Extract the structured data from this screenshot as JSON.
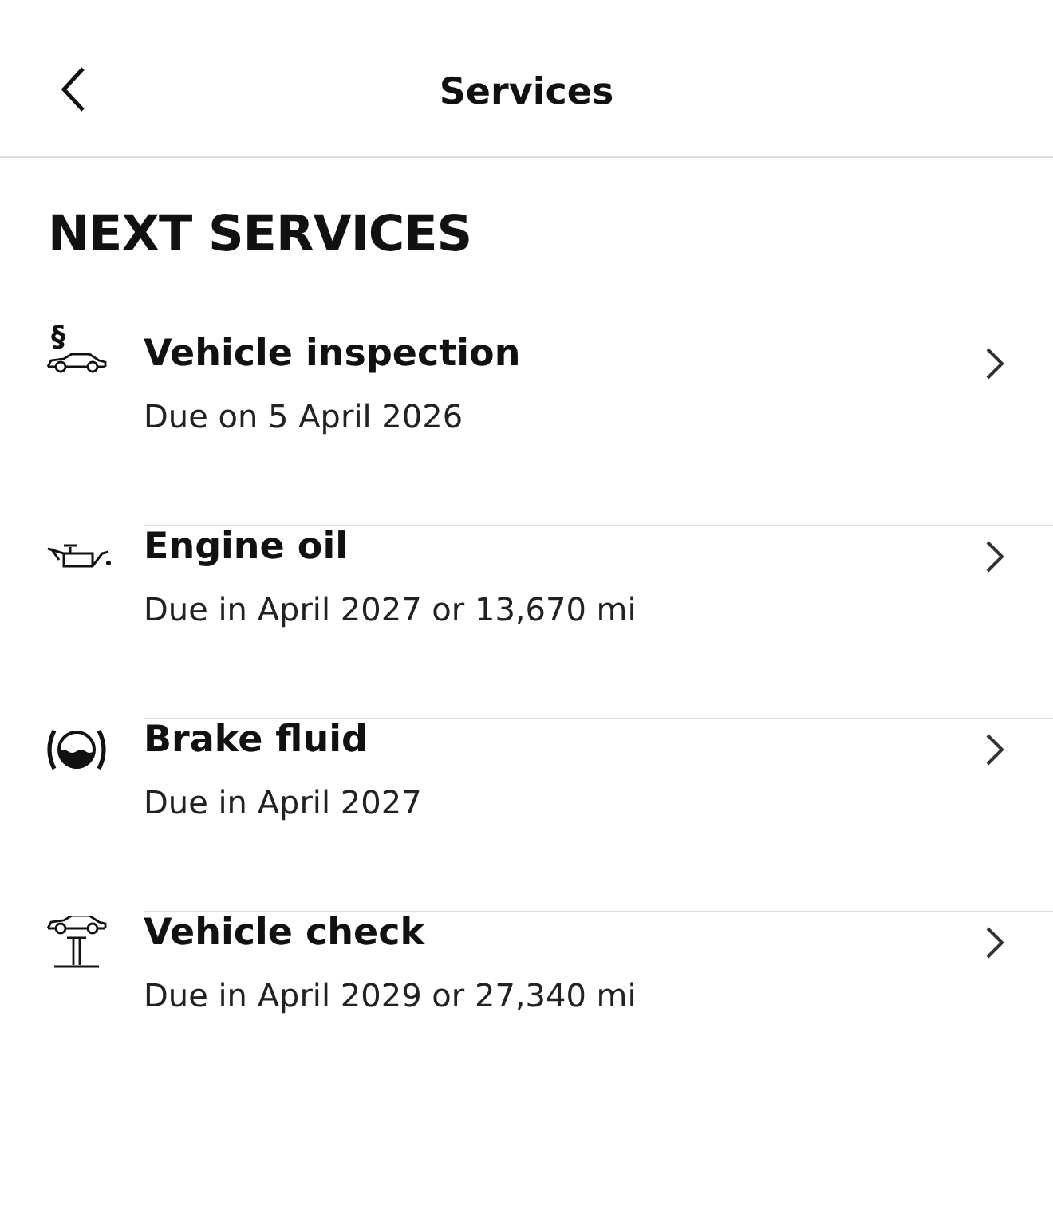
{
  "header": {
    "title": "Services"
  },
  "section": {
    "title": "NEXT SERVICES"
  },
  "services": [
    {
      "kind": "inspection",
      "symbol": "§",
      "title": "Vehicle inspection",
      "due": "Due on 5 April 2026"
    },
    {
      "kind": "oil",
      "title": "Engine oil",
      "due": "Due in April 2027 or 13,670 mi"
    },
    {
      "kind": "brake",
      "title": "Brake fluid",
      "due": "Due in April 2027"
    },
    {
      "kind": "lift",
      "title": "Vehicle check",
      "due": "Due in April 2029 or 27,340 mi"
    }
  ]
}
